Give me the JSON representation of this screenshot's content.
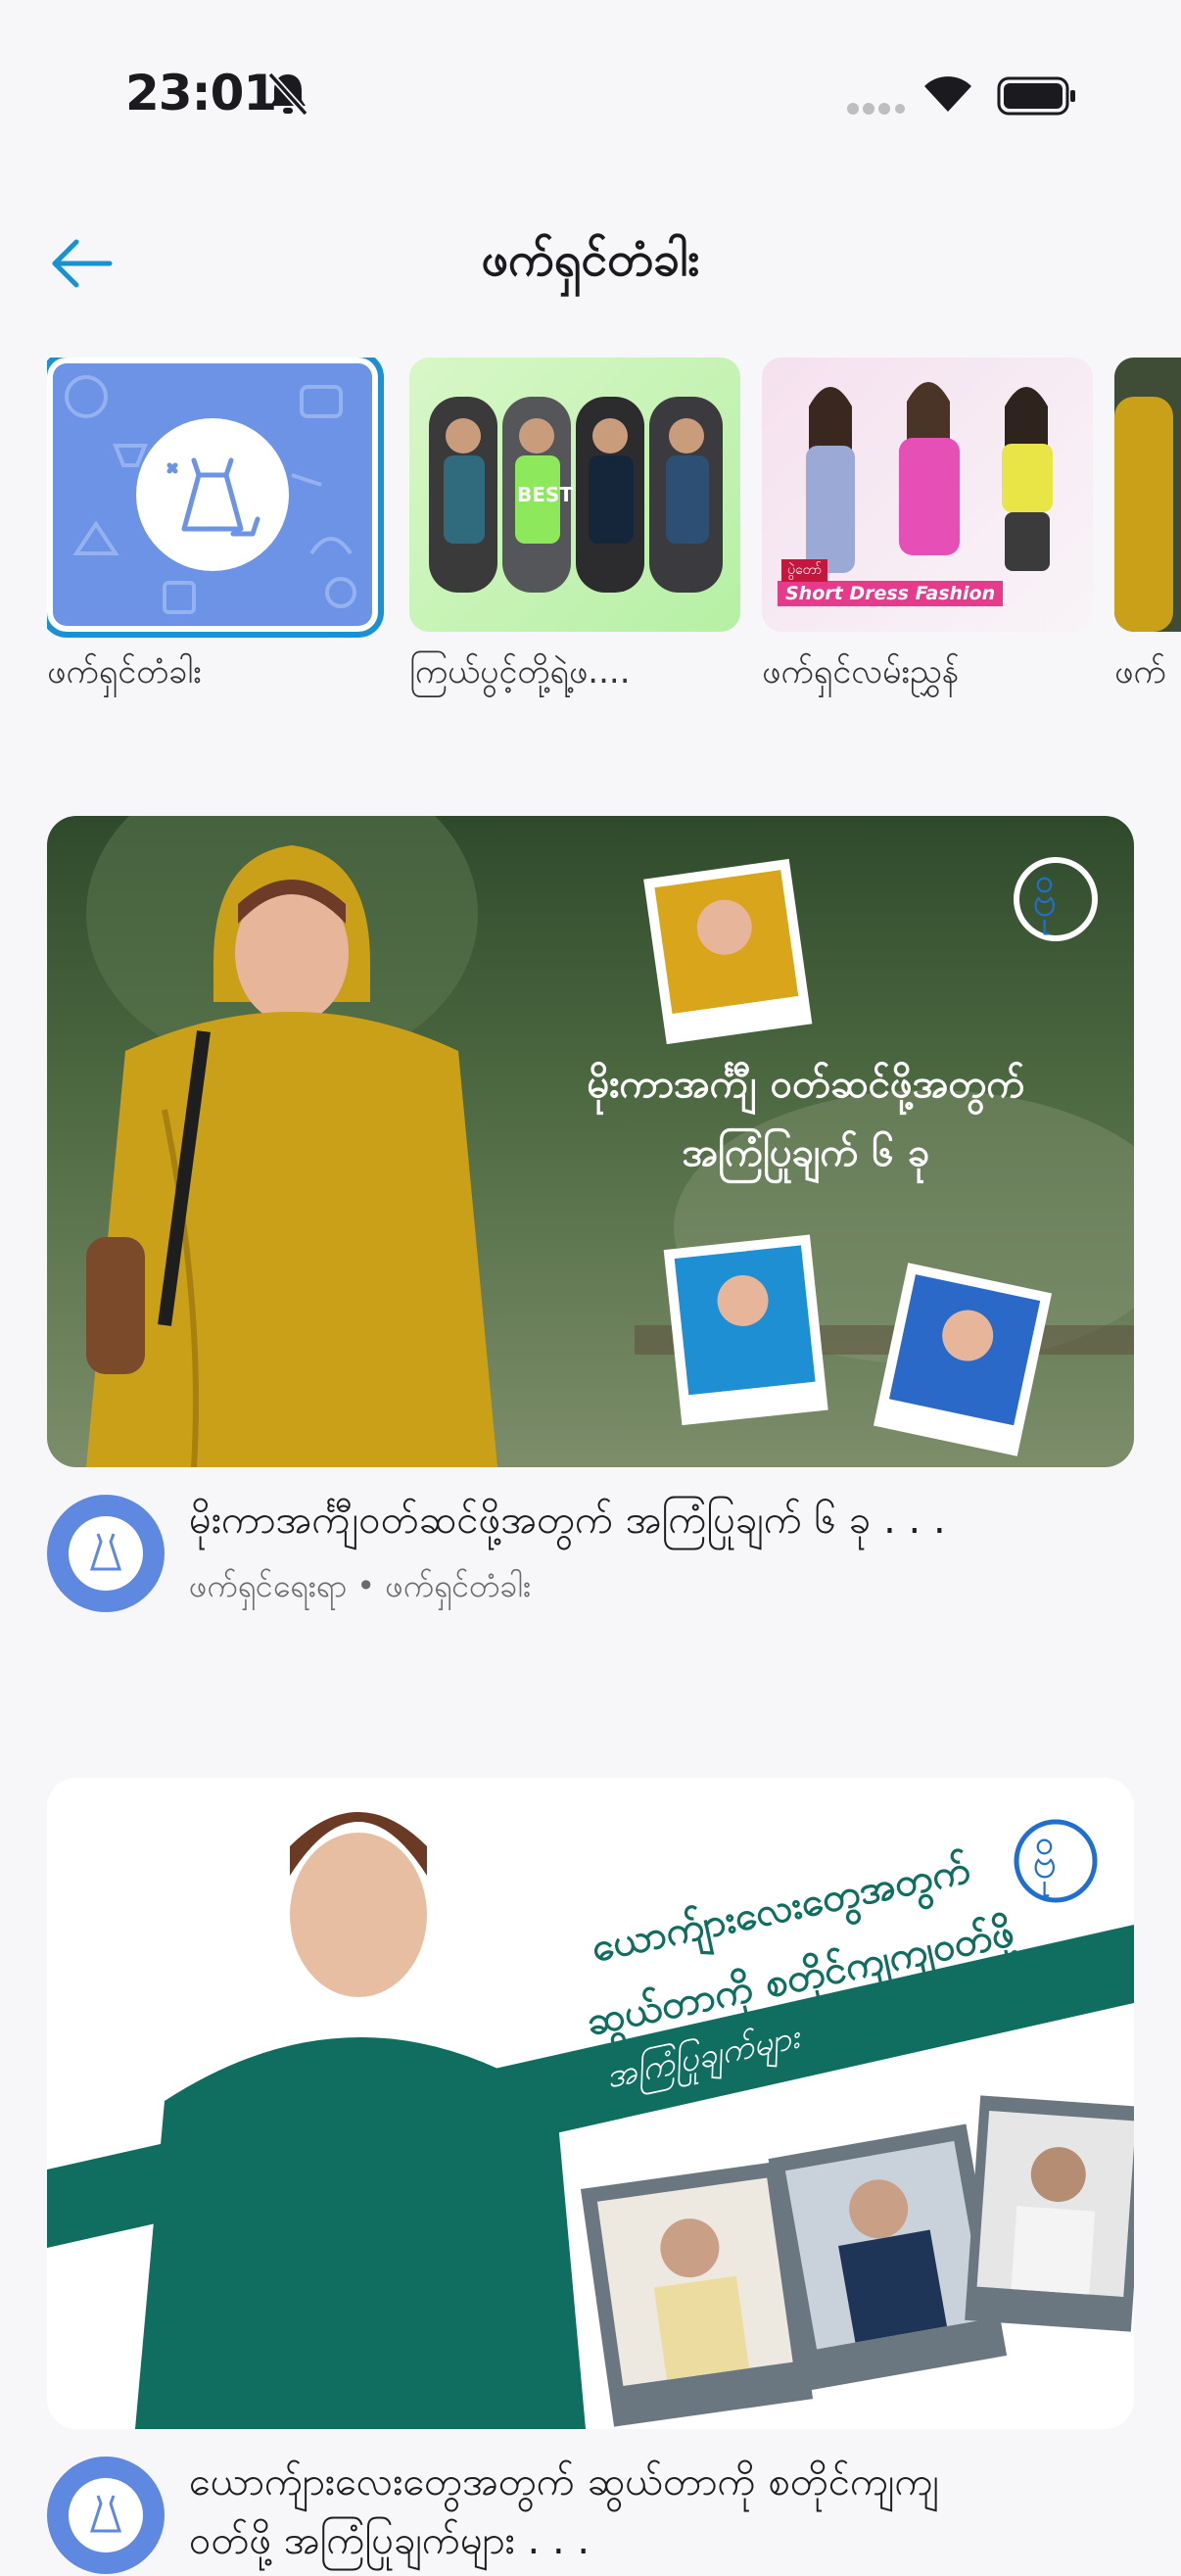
{
  "status_bar": {
    "time": "23:01"
  },
  "header": {
    "title": "ဖက်ရှင်တံခါး"
  },
  "categories": [
    {
      "label": "ဖက်ရှင်တံခါး",
      "selected": true
    },
    {
      "label": "ကြယ်ပွင့်တို့ရဲ့ဖ...."
    },
    {
      "label": "ဖက်ရှင်လမ်းညွှန်"
    },
    {
      "label": "ဖက်"
    }
  ],
  "category_thumb_texts": {
    "fashion_badge": "Short Dress Fashion",
    "fashion_tag": "ပွဲတော်",
    "stars_best": "BEST"
  },
  "posts": [
    {
      "title": "မိုးကာအင်္ကျီဝတ်ဆင်ဖို့အတွက် အကြံပြုချက် ၆ ခု . . .",
      "subtitle": "ဖက်ရှင်ရေးရာ • ဖက်ရှင်တံခါး",
      "image_text_line1": "မိုးကာအင်္ကျီ ဝတ်ဆင်ဖို့အတွက်",
      "image_text_line2": "အကြံပြုချက် ၆ ခု"
    },
    {
      "title": "ယောက်ျားလေးတွေအတွက် ဆွယ်တာကို စတိုင်ကျကျ",
      "title_line2": "ဝတ်ဖို့ အကြံပြုချက်များ . . .",
      "image_text_line1": "ယောက်ျားလေးတွေအတွက်",
      "image_text_line2": "ဆွယ်တာကို စတိုင်ကျကျဝတ်ဖို့",
      "image_text_line3": "အကြံပြုချက်များ"
    }
  ],
  "colors": {
    "accent": "#1991d3",
    "brand_blue": "#5f88e0",
    "teal": "#0f6e5f",
    "rain_yellow": "#c9a018"
  }
}
